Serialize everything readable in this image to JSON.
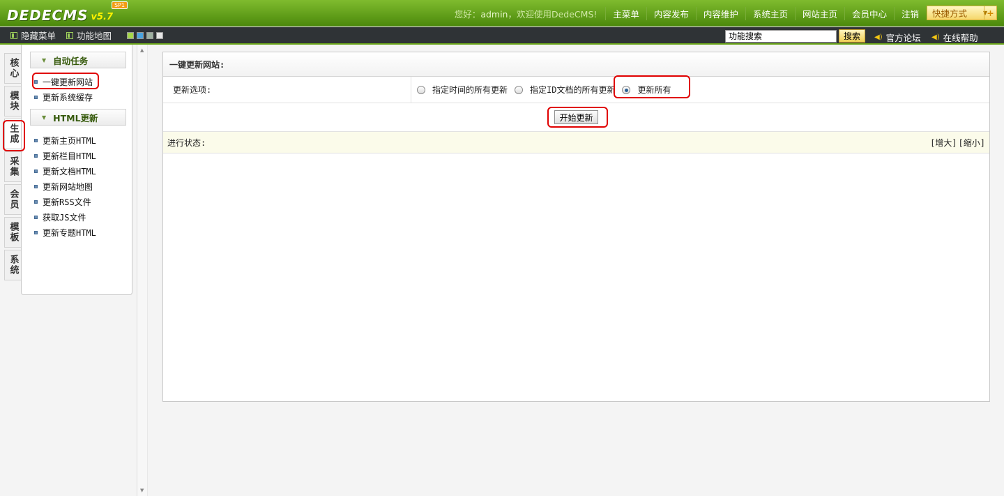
{
  "header": {
    "logo_text": "DEDECMS",
    "logo_version": "v5.7",
    "logo_badge": "SP1",
    "greeting_prefix": "您好：",
    "greeting_user": "admin",
    "greeting_suffix": "，欢迎使用DedeCMS!",
    "nav": [
      "主菜单",
      "内容发布",
      "内容维护",
      "系统主页",
      "网站主页",
      "会员中心",
      "注销"
    ],
    "quick_label": "快捷方式",
    "quick_plus": "+"
  },
  "subbar": {
    "hide_menu": "隐藏菜单",
    "site_map": "功能地图",
    "swatch_colors": [
      "#a5d64a",
      "#4aa3df",
      "#9db0a0",
      "#e6e6e6"
    ],
    "search_value": "功能搜索",
    "search_button": "搜索",
    "forum_link": "官方论坛",
    "help_link": "在线帮助"
  },
  "left_tabs": [
    {
      "label": "核心"
    },
    {
      "label": "模块"
    },
    {
      "label": "生成"
    },
    {
      "label": "采集"
    },
    {
      "label": "会员"
    },
    {
      "label": "模板"
    },
    {
      "label": "系统"
    }
  ],
  "sidebar": {
    "group1_title": "自动任务",
    "group1_items": [
      "一键更新网站",
      "更新系统缓存"
    ],
    "group2_title": "HTML更新",
    "group2_items": [
      "更新主页HTML",
      "更新栏目HTML",
      "更新文档HTML",
      "更新网站地图",
      "更新RSS文件",
      "获取JS文件",
      "更新专题HTML"
    ]
  },
  "main": {
    "title": "一键更新网站:",
    "option_label": "更新选项:",
    "options": [
      "指定时间的所有更新",
      "指定ID文档的所有更新",
      "更新所有"
    ],
    "selected_option": "更新所有",
    "start_button": "开始更新",
    "status_label": "进行状态:",
    "zoom_in": "[增大]",
    "zoom_out": "[缩小]"
  }
}
